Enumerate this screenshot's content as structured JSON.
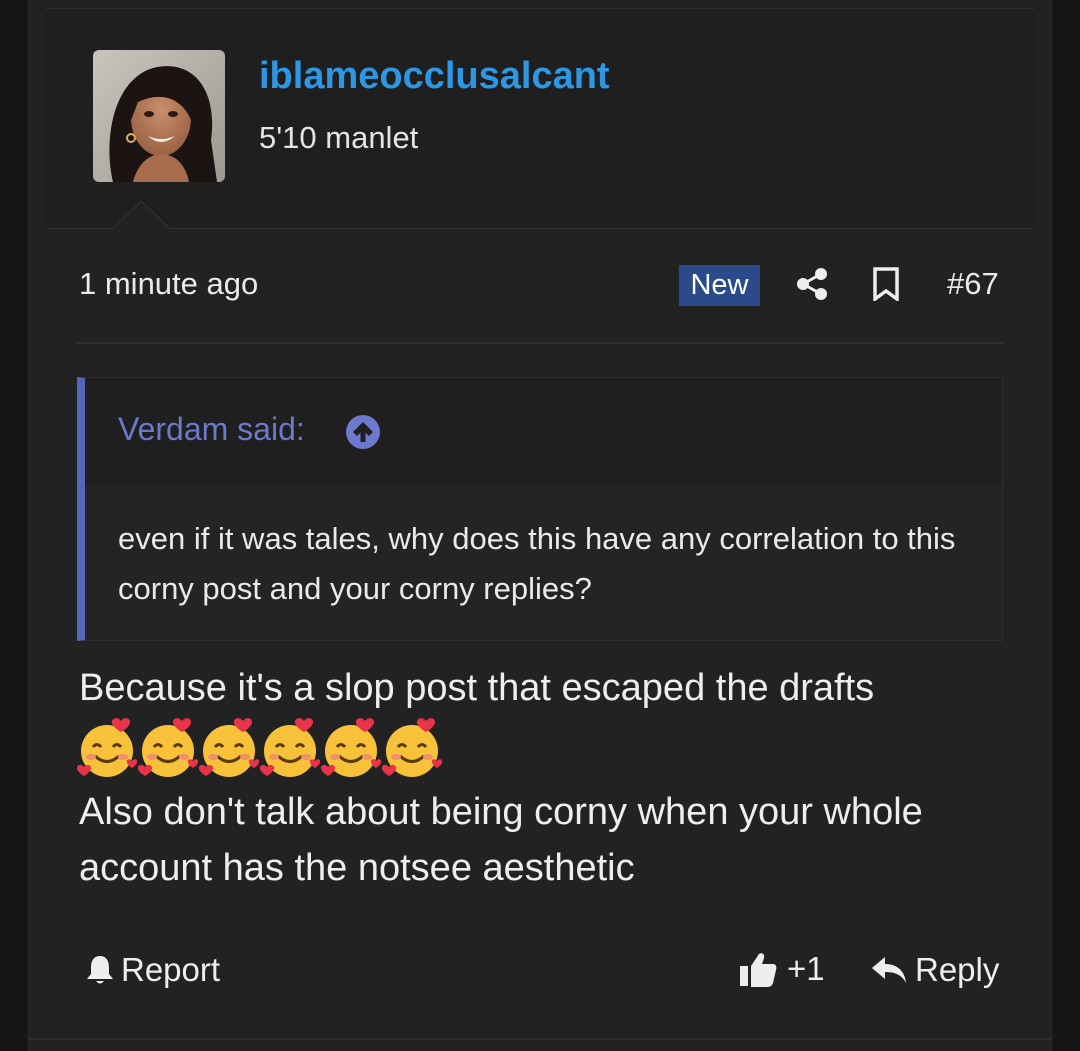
{
  "post": {
    "username": "iblameocclusalcant",
    "user_title": "5'10 manlet",
    "time": "1 minute ago",
    "new_badge": "New",
    "post_number": "#67",
    "quote": {
      "author": "Verdam said:",
      "text": "even if it was tales, why does this have any correlation to this corny post and your corny replies?"
    },
    "message": {
      "line1": "Because it's a slop post that escaped the drafts",
      "emojis": [
        "smiling-face-with-hearts-emoji",
        "smiling-face-with-hearts-emoji",
        "smiling-face-with-hearts-emoji",
        "smiling-face-with-hearts-emoji",
        "smiling-face-with-hearts-emoji",
        "smiling-face-with-hearts-emoji"
      ],
      "line2": "Also don't talk about being corny when your whole",
      "line3": "account has the notsee aesthetic"
    },
    "actions": {
      "report": "Report",
      "like_count": "+1",
      "reply": "Reply"
    }
  },
  "icons": [
    "avatar-photo",
    "share-icon",
    "bookmark-icon",
    "arrow-up-circle-icon",
    "bell-icon",
    "thumbs-up-icon",
    "reply-arrow-icon"
  ],
  "colors": {
    "username": "#2e97e3",
    "new_badge": "#2a4a8a",
    "quote_accent": "#5765b6",
    "background": "#222222"
  }
}
